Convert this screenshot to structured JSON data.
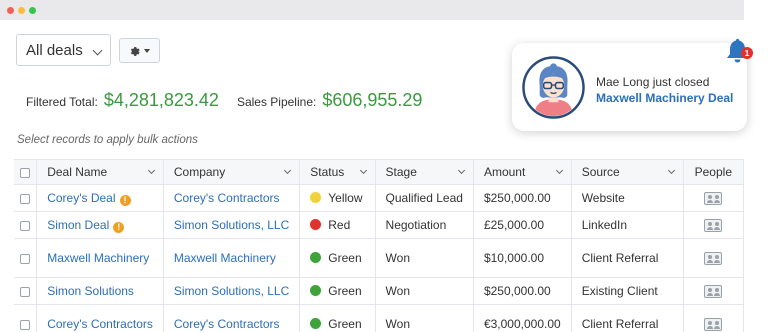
{
  "toolbar": {
    "view_dropdown_label": "All deals",
    "settings_icon": "gear-icon"
  },
  "totals": {
    "filtered_label": "Filtered Total:",
    "filtered_value": "$4,281,823.42",
    "pipeline_label": "Sales Pipeline:",
    "pipeline_value": "$606,955.29"
  },
  "bulk_hint": "Select records to apply bulk actions",
  "columns": {
    "deal_name": "Deal Name",
    "company": "Company",
    "status": "Status",
    "stage": "Stage",
    "amount": "Amount",
    "source": "Source",
    "people": "People"
  },
  "rows": [
    {
      "deal": "Corey's Deal",
      "warn": "!",
      "company": "Corey's Contractors",
      "status": "Yellow",
      "status_color": "#f2d23a",
      "stage": "Qualified Lead",
      "amount": "$250,000.00",
      "source": "Website"
    },
    {
      "deal": "Simon Deal",
      "warn": "!",
      "company": "Simon Solutions, LLC",
      "status": "Red",
      "status_color": "#e0332e",
      "stage": "Negotiation",
      "amount": "£25,000.00",
      "source": "LinkedIn"
    },
    {
      "deal": "Maxwell Machinery",
      "company": "Maxwell Machinery",
      "status": "Green",
      "status_color": "#3fa23a",
      "stage": "Won",
      "amount": "$10,000.00",
      "source": "Client Referral"
    },
    {
      "deal": "Simon Solutions",
      "company": "Simon Solutions, LLC",
      "status": "Green",
      "status_color": "#3fa23a",
      "stage": "Won",
      "amount": "$250,000.00",
      "source": "Existing Client"
    },
    {
      "deal": "Corey's Contractors",
      "company": "Corey's Contractors",
      "status": "Green",
      "status_color": "#3fa23a",
      "stage": "Won",
      "amount": "€3,000,000.00",
      "source": "Client Referral"
    }
  ],
  "notification": {
    "message": "Mae Long just closed",
    "deal_link": "Maxwell Machinery Deal",
    "avatar_icon": "user-avatar-icon"
  },
  "bell": {
    "icon": "bell-icon",
    "badge_count": "1",
    "color": "#2f74c0"
  }
}
